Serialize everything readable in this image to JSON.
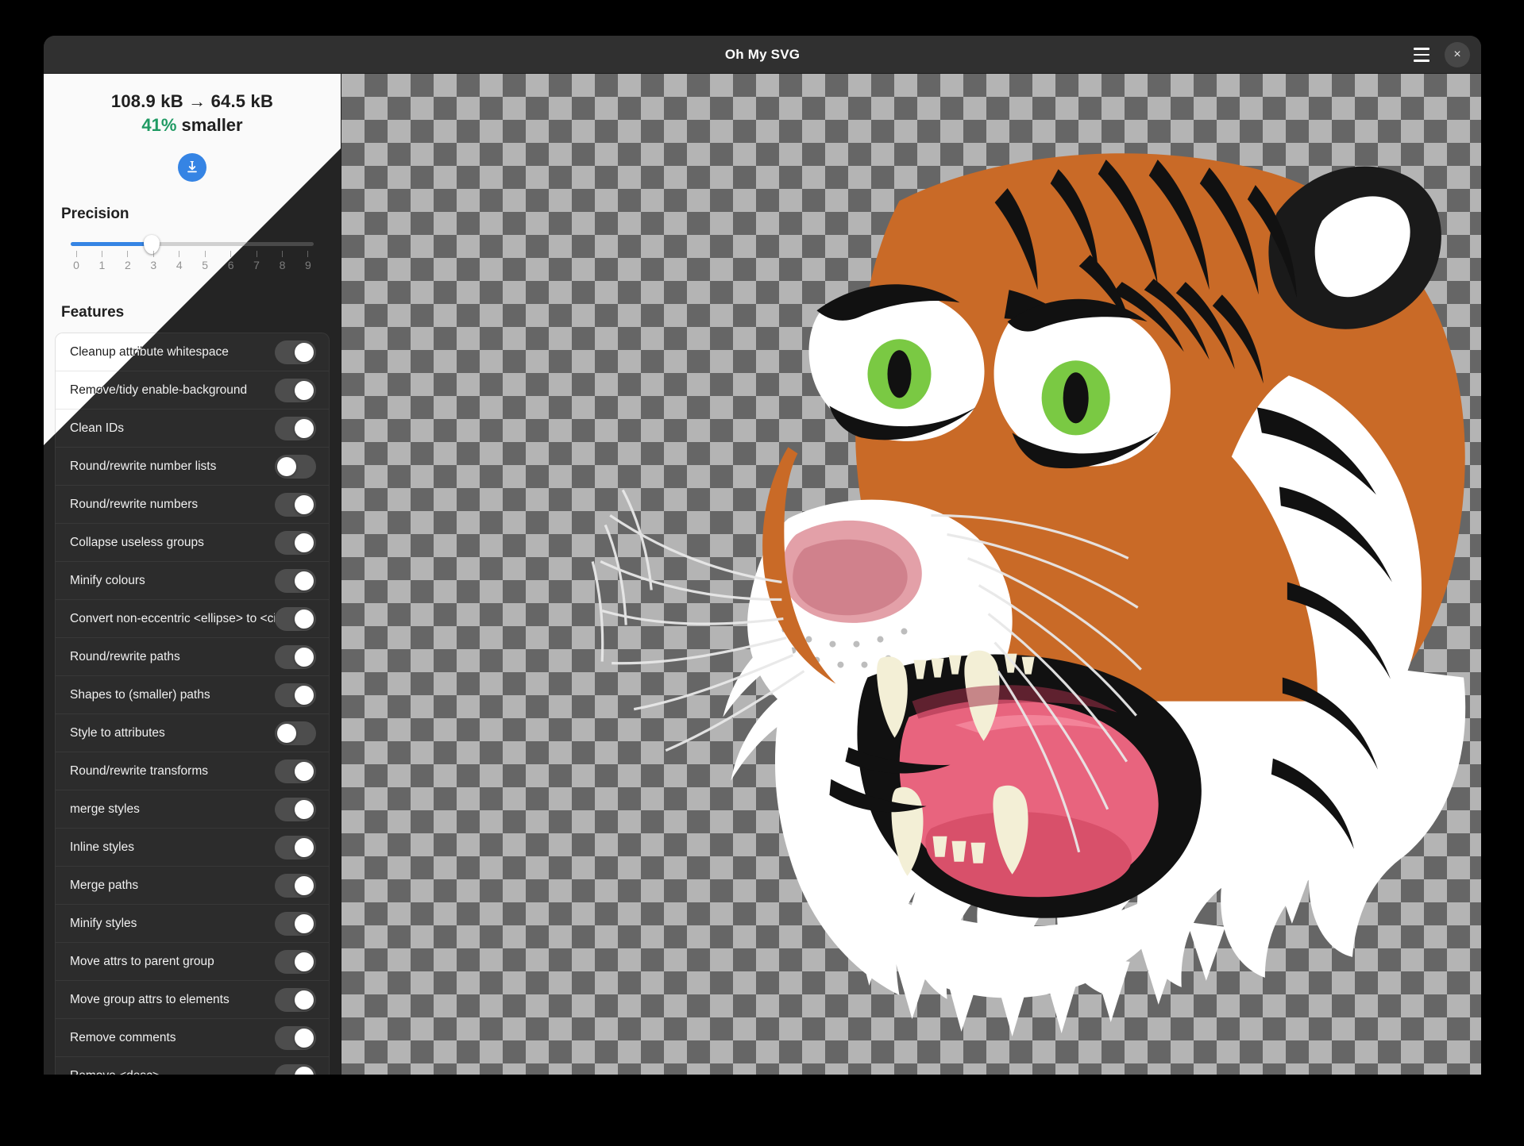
{
  "window": {
    "title": "Oh My SVG",
    "menu_icon": "hamburger-icon",
    "close_icon": "×"
  },
  "sidebar": {
    "stats": {
      "size_before": "108.9 kB",
      "arrow": "→",
      "size_after": "64.5 kB",
      "size_line": "108.9 kB → 64.5 kB",
      "percent": "41%",
      "percent_suffix": " smaller",
      "download_icon": "download-icon",
      "accent_color": "#3584e4",
      "success_color": "#2ec27e"
    },
    "precision": {
      "title": "Precision",
      "value": 3,
      "min": 0,
      "max": 9,
      "ticks": [
        "0",
        "1",
        "2",
        "3",
        "4",
        "5",
        "6",
        "7",
        "8",
        "9"
      ]
    },
    "features": {
      "title": "Features",
      "items": [
        {
          "label": "Cleanup attribute whitespace",
          "on": true
        },
        {
          "label": "Remove/tidy enable-background",
          "on": true
        },
        {
          "label": "Clean IDs",
          "on": true
        },
        {
          "label": "Round/rewrite number lists",
          "on": false
        },
        {
          "label": "Round/rewrite numbers",
          "on": true
        },
        {
          "label": "Collapse useless groups",
          "on": true
        },
        {
          "label": "Minify colours",
          "on": true
        },
        {
          "label": "Convert non-eccentric <ellipse> to <circle>",
          "on": true
        },
        {
          "label": "Round/rewrite paths",
          "on": true
        },
        {
          "label": "Shapes to (smaller) paths",
          "on": true
        },
        {
          "label": "Style to attributes",
          "on": false
        },
        {
          "label": "Round/rewrite transforms",
          "on": true
        },
        {
          "label": "merge styles",
          "on": true
        },
        {
          "label": "Inline styles",
          "on": true
        },
        {
          "label": "Merge paths",
          "on": true
        },
        {
          "label": "Minify styles",
          "on": true
        },
        {
          "label": "Move attrs to parent group",
          "on": true
        },
        {
          "label": "Move group attrs to elements",
          "on": true
        },
        {
          "label": "Remove comments",
          "on": true
        },
        {
          "label": "Remove <desc>",
          "on": true
        },
        {
          "label": "",
          "on": false
        }
      ]
    }
  },
  "canvas": {
    "name": "svg-preview-canvas",
    "checker_light": "#b4b4b4",
    "checker_dark": "#666666",
    "artwork": "tiger-head-illustration",
    "palette": {
      "orange": "#c96a27",
      "orange_dark": "#a8441a",
      "black": "#111111",
      "white": "#ffffff",
      "eye_green": "#7ac943",
      "mouth_pink": "#e8647e",
      "mouth_dark": "#b23a52",
      "tooth": "#f3efd6",
      "nose_pink": "#e3a0a8"
    }
  }
}
